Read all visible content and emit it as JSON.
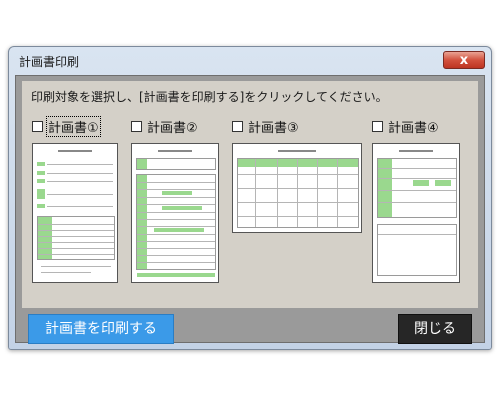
{
  "window": {
    "title": "計画書印刷",
    "close_icon": "x"
  },
  "instruction": "印刷対象を選択し、[計画書を印刷する]をクリックしてください。",
  "plans": [
    {
      "label": "計画書①",
      "checked": false
    },
    {
      "label": "計画書②",
      "checked": false
    },
    {
      "label": "計画書③",
      "checked": false
    },
    {
      "label": "計画書④",
      "checked": false
    }
  ],
  "buttons": {
    "print": "計画書を印刷する",
    "close": "閉じる"
  },
  "colors": {
    "print_button": "#3b9ae8",
    "close_button": "#262626",
    "form_highlight": "#9ad88e"
  }
}
